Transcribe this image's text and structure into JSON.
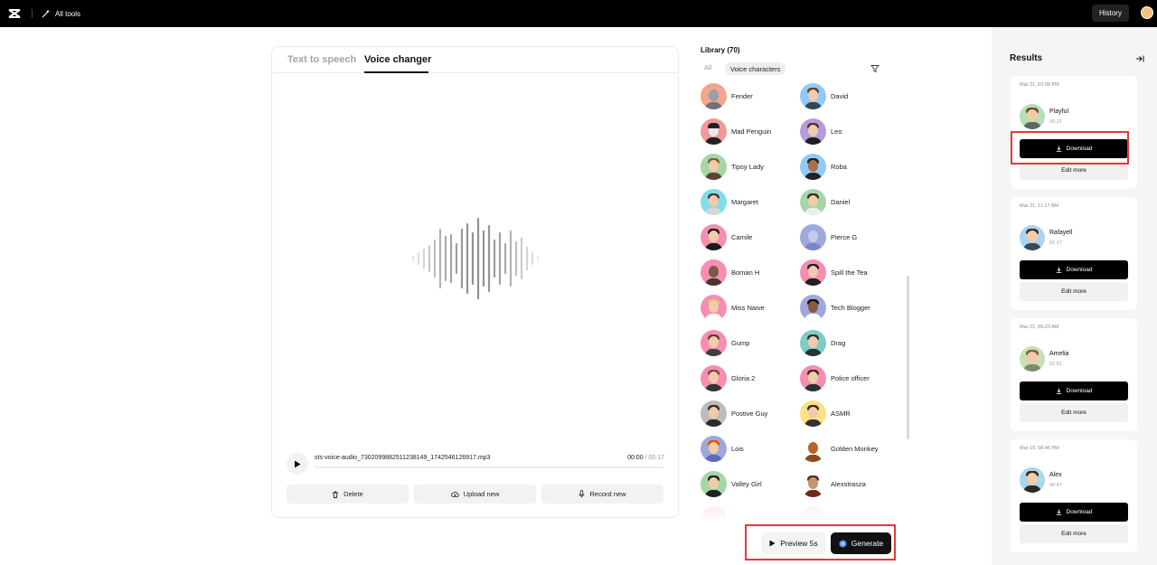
{
  "topbar": {
    "all_tools_label": "All tools",
    "history_label": "History"
  },
  "editor": {
    "tabs": [
      "Text to speech",
      "Voice changer"
    ],
    "active_tab": "Voice changer",
    "player": {
      "filename": "sts-voice-audio_7302099882511238149_1742546126917.mp3",
      "current_time": "00:00",
      "separator": "/",
      "total_time": "00:17"
    },
    "actions": {
      "delete": "Delete",
      "upload": "Upload new",
      "record": "Record new"
    }
  },
  "library": {
    "title": "Library (70)",
    "filter_all": "All",
    "filter_active": "Voice characters",
    "voices_left": [
      "Fender",
      "Mad Penguin",
      "Tipsy Lady",
      "Margaret",
      "Camile",
      "Boman H",
      "Miss Naive",
      "Gump",
      "Gloria 2",
      "Postive Guy",
      "Lois",
      "Valley Girl"
    ],
    "voices_right": [
      "David",
      "Leo",
      "Roba",
      "Daniel",
      "Pierce G",
      "Spill the Tea",
      "Tech Blogger",
      "Drag",
      "Police officer",
      "ASMR",
      "Golden Monkey",
      "Alexstrasza"
    ]
  },
  "generate": {
    "preview_label": "Preview 5s",
    "generate_label": "Generate"
  },
  "results": {
    "title": "Results",
    "download_label": "Download",
    "edit_label": "Edit more",
    "items": [
      {
        "date": "Mar 21, 02:08 PM",
        "name": "Playful",
        "duration": "00:17"
      },
      {
        "date": "Mar 21, 11:17 AM",
        "name": "Rafayell",
        "duration": "01:17"
      },
      {
        "date": "Mar 21, 09:23 AM",
        "name": "Amelia",
        "duration": "01:01"
      },
      {
        "date": "Mar 19, 08:46 PM",
        "name": "Alex",
        "duration": "00:47"
      }
    ]
  },
  "colors": {
    "highlight": "#e53935",
    "primary_button": "#000000",
    "muted_text": "#999999"
  }
}
